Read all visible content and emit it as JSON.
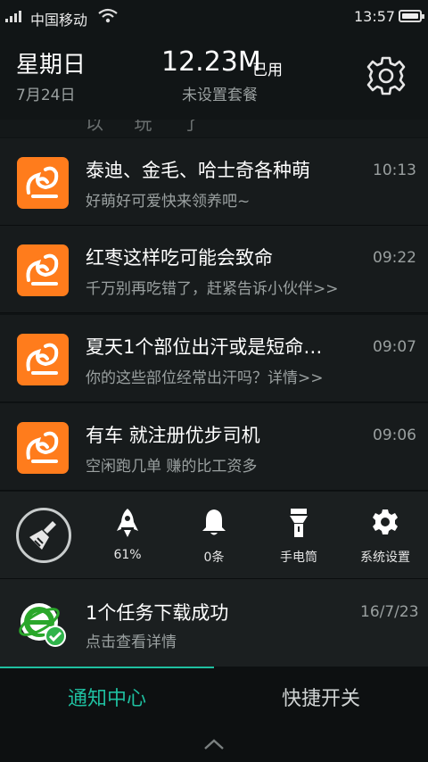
{
  "status_bar": {
    "carrier": "中国移动",
    "time": "13:57"
  },
  "header": {
    "weekday": "星期日",
    "date": "7月24日",
    "data_used": "12.23M",
    "data_unit": "已用",
    "plan_status": "未设置套餐"
  },
  "partial_text": "以 玩 了",
  "notifications": [
    {
      "title": "泰迪、金毛、哈士奇各种萌",
      "body": "好萌好可爱快来领养吧~",
      "time": "10:13",
      "icon": "uc-browser-icon"
    },
    {
      "title": "红枣这样吃可能会致命",
      "body": "千万别再吃错了，赶紧告诉小伙伴>>",
      "time": "09:22",
      "icon": "uc-browser-icon"
    },
    {
      "title": "夏天1个部位出汗或是短命…",
      "body": "你的这些部位经常出汗吗？详情>>",
      "time": "09:07",
      "icon": "uc-browser-icon"
    },
    {
      "title": "有车  就注册优步司机",
      "body": "空闲跑几单  赚的比工资多",
      "time": "09:06",
      "icon": "uc-browser-icon"
    }
  ],
  "quick_bar": {
    "clean_icon": "broom-icon",
    "items": [
      {
        "label": "61%",
        "icon": "rocket-icon"
      },
      {
        "label": "0条",
        "icon": "bell-icon"
      },
      {
        "label": "手电筒",
        "icon": "flashlight-icon"
      },
      {
        "label": "系统设置",
        "icon": "gear-icon"
      }
    ]
  },
  "download": {
    "title": "1个任务下载成功",
    "body": "点击查看详情",
    "time": "16/7/23",
    "icon": "ie-browser-check-icon"
  },
  "tabs": [
    {
      "label": "通知中心",
      "active": true
    },
    {
      "label": "快捷开关",
      "active": false
    }
  ],
  "colors": {
    "accent": "#1fbfa0",
    "uc_orange": "#ff7c1c",
    "background": "#0f1314"
  }
}
